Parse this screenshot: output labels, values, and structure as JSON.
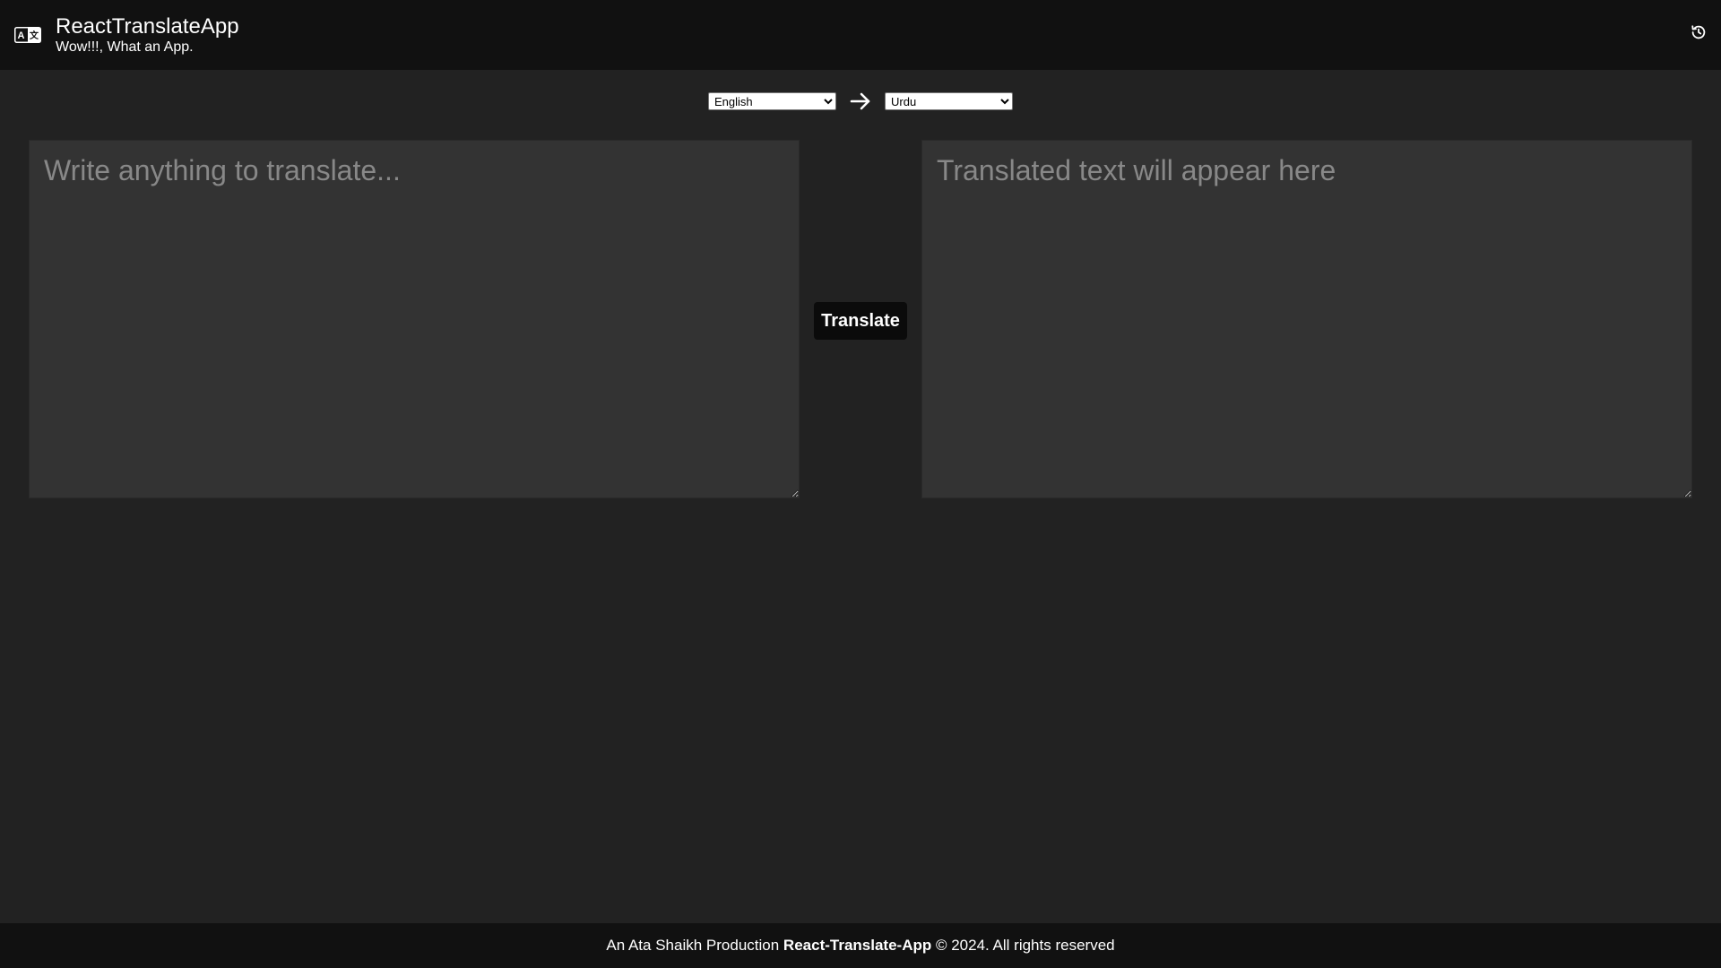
{
  "header": {
    "title": "ReactTranslateApp",
    "subtitle": "Wow!!!, What an App.",
    "logo_icon": "translate-icon",
    "history_icon": "history-icon"
  },
  "languages": {
    "source": {
      "selected": "English",
      "options": [
        "English"
      ]
    },
    "arrow_icon": "arrow-right-icon",
    "target": {
      "selected": "Urdu",
      "options": [
        "Urdu"
      ]
    }
  },
  "editor": {
    "source_placeholder": "Write anything to translate...",
    "source_value": "",
    "target_placeholder": "Translated text will appear here",
    "target_value": ""
  },
  "actions": {
    "translate_label": "Translate"
  },
  "footer": {
    "prefix": "An Ata Shaikh Production ",
    "app_name": "React-Translate-App",
    "suffix": " © 2024. All rights reserved"
  },
  "colors": {
    "background": "#222222",
    "header_bg": "#111111",
    "panel_bg": "#333333",
    "button_bg": "#0b0b0b",
    "text": "#ffffff",
    "placeholder": "#888888"
  }
}
